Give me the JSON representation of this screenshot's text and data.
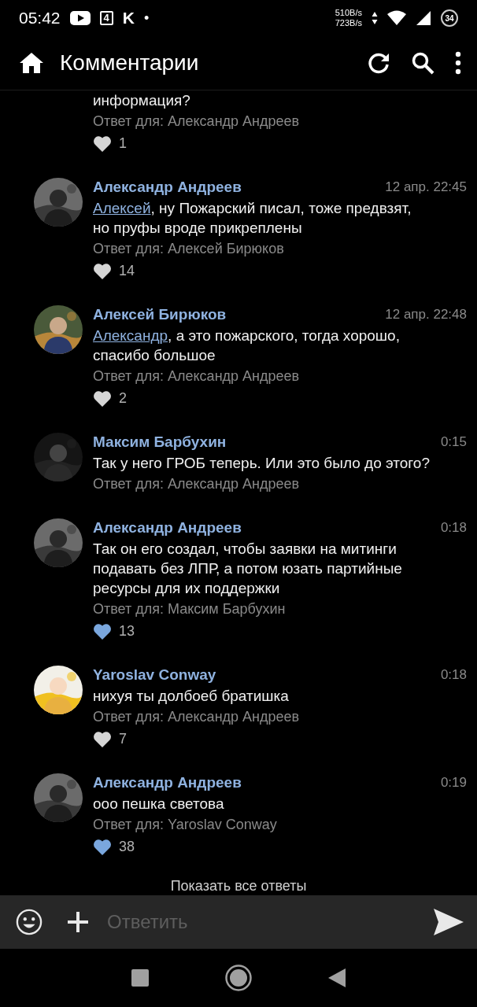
{
  "status_bar": {
    "time": "05:42",
    "notification_box_label": "4",
    "notification_letter": "K",
    "notification_dot": "•",
    "upload_speed": "510B/s",
    "download_speed": "723B/s",
    "battery": "34"
  },
  "app_bar": {
    "title": "Комментарии"
  },
  "comments": [
    {
      "lines": [
        "информация?"
      ],
      "reply_to": "Ответ для: Александр Андреев",
      "likes": "1",
      "liked": false
    },
    {
      "author": "Александр Андреев",
      "time": "12 апр. 22:45",
      "mention": "Алексей",
      "lines": [
        ", ну Пожарский писал, тоже предвзят,",
        "но пруфы вроде прикреплены"
      ],
      "reply_to": "Ответ для: Алексей Бирюков",
      "likes": "14",
      "liked": false
    },
    {
      "author": "Алексей Бирюков",
      "time": "12 апр. 22:48",
      "mention": "Александр",
      "lines": [
        ", а это пожарского, тогда хорошо,",
        "спасибо большое"
      ],
      "reply_to": "Ответ для: Александр Андреев",
      "likes": "2",
      "liked": false
    },
    {
      "author": "Максим Барбухин",
      "time": "0:15",
      "lines": [
        "Так у него ГРОБ теперь. Или это было до этого?"
      ],
      "reply_to": "Ответ для: Александр Андреев"
    },
    {
      "author": "Александр Андреев",
      "time": "0:18",
      "lines": [
        "Так он его создал, чтобы заявки на митинги",
        "подавать без ЛПР, а потом юзать партийные",
        "ресурсы для их поддержки"
      ],
      "reply_to": "Ответ для: Максим Барбухин",
      "likes": "13",
      "liked": true
    },
    {
      "author": "Yaroslav Conway",
      "time": "0:18",
      "lines": [
        "нихуя ты долбоеб братишка"
      ],
      "reply_to": "Ответ для: Александр Андреев",
      "likes": "7",
      "liked": false
    },
    {
      "author": "Александр Андреев",
      "time": "0:19",
      "lines": [
        "ооо пешка светова"
      ],
      "reply_to": "Ответ для: Yaroslav Conway",
      "likes": "38",
      "liked": true
    }
  ],
  "show_all": "Показать все ответы",
  "reply_bar": {
    "placeholder": "Ответить"
  }
}
